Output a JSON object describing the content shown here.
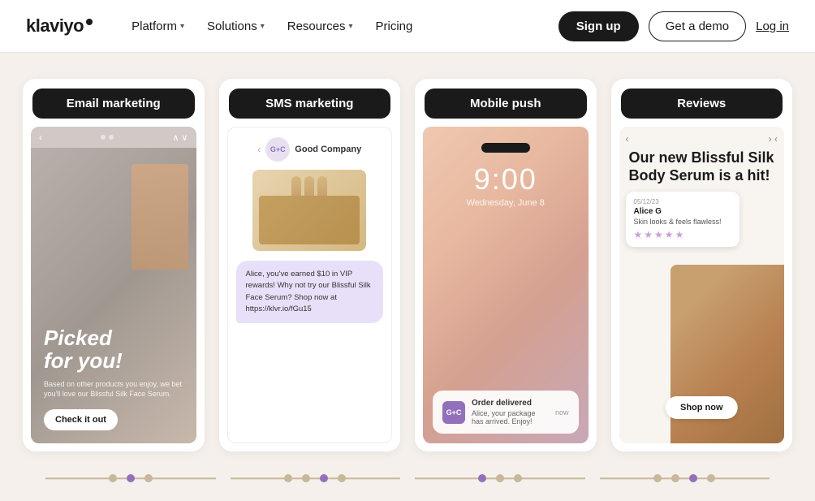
{
  "nav": {
    "logo": "klaviyo",
    "links": [
      {
        "label": "Platform",
        "hasDropdown": true
      },
      {
        "label": "Solutions",
        "hasDropdown": true
      },
      {
        "label": "Resources",
        "hasDropdown": true
      },
      {
        "label": "Pricing",
        "hasDropdown": false
      }
    ],
    "signup_label": "Sign up",
    "demo_label": "Get a demo",
    "login_label": "Log in"
  },
  "cards": [
    {
      "id": "email",
      "header": "Email marketing",
      "content": {
        "headline_line1": "Picked",
        "headline_line2": "for you!",
        "subtext": "Based on other products you enjoy, we bet you'll love our Blissful Silk Face Serum.",
        "cta": "Check it out"
      }
    },
    {
      "id": "sms",
      "header": "SMS marketing",
      "content": {
        "company": "Good Company",
        "message": "Alice, you've earned $10 in VIP rewards! Why not try our Blissful Silk Face Serum?\n\nShop now at https://klvr.io/fGu15"
      }
    },
    {
      "id": "push",
      "header": "Mobile push",
      "content": {
        "time": "9:00",
        "date": "Wednesday, June 8",
        "notif_title": "Order delivered",
        "notif_body": "Alice, your package has arrived. Enjoy!",
        "notif_time": "now"
      }
    },
    {
      "id": "reviews",
      "header": "Reviews",
      "content": {
        "headline": "Our new Blissful Silk Body Serum is a hit!",
        "review_date": "05/12/23",
        "reviewer": "Alice G",
        "review_text": "Skin looks & feels flawless!",
        "stars": 5,
        "shop_label": "Shop now"
      }
    }
  ],
  "timeline": {
    "tracks": [
      {
        "dots": [
          {
            "active": false
          },
          {
            "active": true
          },
          {
            "active": false
          }
        ]
      },
      {
        "dots": [
          {
            "active": false
          },
          {
            "active": false
          },
          {
            "active": true
          },
          {
            "active": false
          }
        ]
      },
      {
        "dots": [
          {
            "active": true
          },
          {
            "active": false
          },
          {
            "active": false
          }
        ]
      },
      {
        "dots": [
          {
            "active": false
          },
          {
            "active": false
          },
          {
            "active": true
          },
          {
            "active": false
          }
        ]
      }
    ]
  }
}
